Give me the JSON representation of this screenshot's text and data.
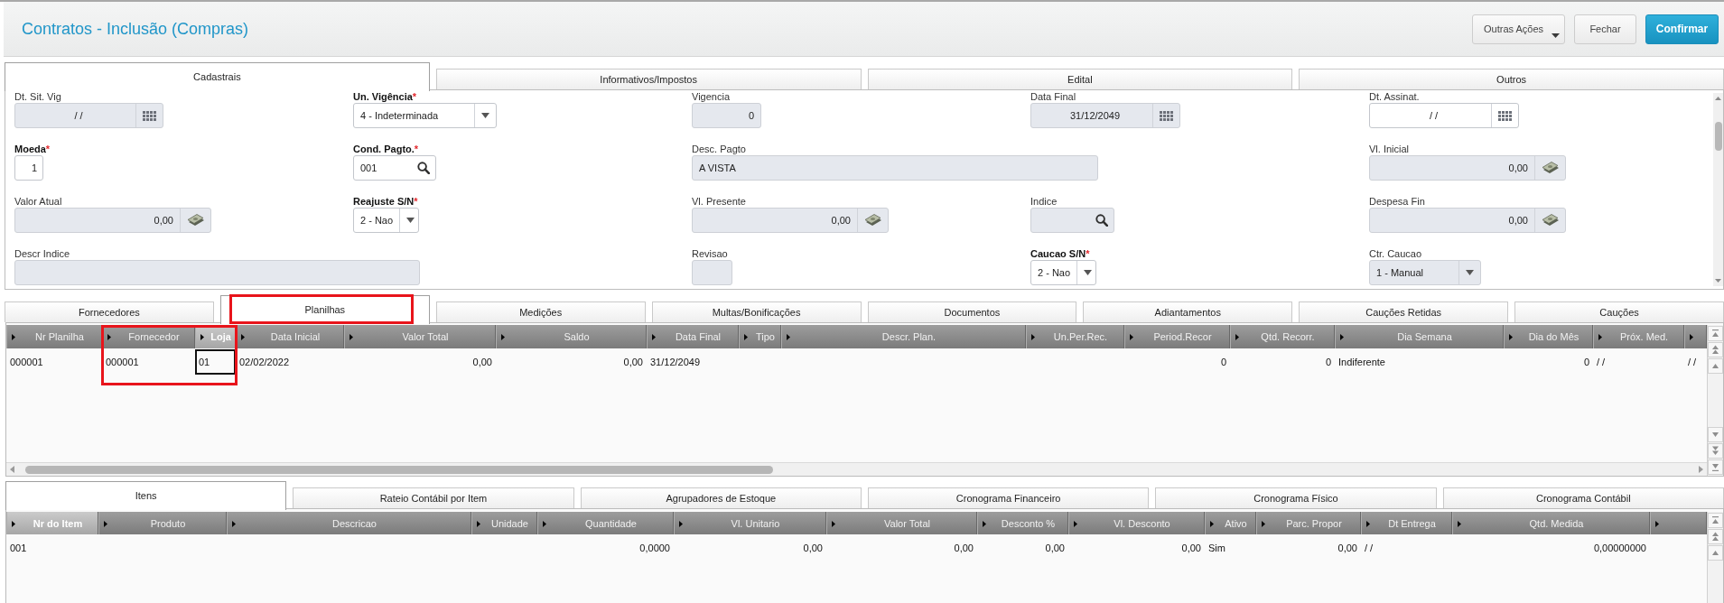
{
  "header": {
    "title": "Contratos - Inclusão (Compras)",
    "buttons": [
      {
        "label": "Outras Ações",
        "kind": "menu"
      },
      {
        "label": "Fechar",
        "kind": "default"
      },
      {
        "label": "Confirmar",
        "kind": "primary"
      }
    ]
  },
  "main_tabs": [
    {
      "label": "Cadastrais",
      "selected": true
    },
    {
      "label": "Informativos/Impostos",
      "selected": false
    },
    {
      "label": "Edital",
      "selected": false
    },
    {
      "label": "Outros",
      "selected": false
    }
  ],
  "form": {
    "rows": [
      {
        "fields": [
          {
            "label": "Dt. Sit. Vig",
            "required": false,
            "kind": "date",
            "value": "/ /",
            "disabled": true
          },
          {
            "label": "Un. Vigência",
            "required": true,
            "required_mark": "*",
            "kind": "select",
            "value": "4 - Indeterminada",
            "disabled": false
          },
          {
            "label": "Vigencia",
            "required": false,
            "kind": "number",
            "value": "0",
            "disabled": true
          },
          {
            "label": "Data Final",
            "required": false,
            "kind": "date",
            "value": "31/12/2049",
            "disabled": true
          },
          {
            "label": "Dt. Assinat.",
            "required": false,
            "kind": "date",
            "value": "/ /",
            "disabled": false
          }
        ]
      },
      {
        "fields": [
          {
            "label": "Moeda",
            "required": true,
            "required_mark": "*",
            "kind": "number",
            "value": "1",
            "disabled": false
          },
          {
            "label": "Cond. Pagto.",
            "required": true,
            "required_mark": "*",
            "kind": "lookup",
            "value": "001",
            "disabled": false
          },
          {
            "label": "Desc. Pagto",
            "required": false,
            "kind": "text",
            "value": "A VISTA",
            "disabled": true
          },
          {
            "label": "Vl. Inicial",
            "required": false,
            "kind": "money",
            "value": "0,00",
            "disabled": true
          }
        ]
      },
      {
        "fields": [
          {
            "label": "Valor Atual",
            "required": false,
            "kind": "money",
            "value": "0,00",
            "disabled": true
          },
          {
            "label": "Reajuste S/N",
            "required": true,
            "required_mark": "*",
            "kind": "select",
            "value": "2 - Nao",
            "disabled": false
          },
          {
            "label": "Vl. Presente",
            "required": false,
            "kind": "money",
            "value": "0,00",
            "disabled": true
          },
          {
            "label": "Indice",
            "required": false,
            "kind": "lookup",
            "disabled": true
          },
          {
            "label": "Despesa Fin",
            "required": false,
            "kind": "money",
            "value": "0,00",
            "disabled": true
          }
        ]
      },
      {
        "fields": [
          {
            "label": "Descr Indice",
            "required": false,
            "kind": "text",
            "disabled": true
          },
          {
            "label": "Revisao",
            "required": false,
            "kind": "number",
            "disabled": true
          },
          {
            "label": "Caucao S/N",
            "required": true,
            "required_mark": "*",
            "kind": "select",
            "value": "2 - Nao",
            "disabled": false
          },
          {
            "label": "Ctr. Caucao",
            "required": false,
            "kind": "select",
            "value": "1 - Manual",
            "disabled": true
          }
        ]
      }
    ]
  },
  "sub_tabs": [
    {
      "label": "Fornecedores",
      "selected": false,
      "highlighted": false
    },
    {
      "label": "Planilhas",
      "selected": true,
      "highlighted": true
    },
    {
      "label": "Medições",
      "selected": false,
      "highlighted": false
    },
    {
      "label": "Multas/Bonificações",
      "selected": false,
      "highlighted": false
    },
    {
      "label": "Documentos",
      "selected": false,
      "highlighted": false
    },
    {
      "label": "Adiantamentos",
      "selected": false,
      "highlighted": false
    },
    {
      "label": "Cauções Retidas",
      "selected": false,
      "highlighted": false
    },
    {
      "label": "Cauções",
      "selected": false,
      "highlighted": false
    }
  ],
  "planilhas": {
    "columns": [
      {
        "label": "Nr Planilha",
        "kind": "text",
        "selected": false,
        "highlighted": false
      },
      {
        "label": "Fornecedor",
        "kind": "text",
        "selected": false,
        "highlighted": true
      },
      {
        "label": "Loja",
        "kind": "text",
        "selected": true,
        "highlighted": true
      },
      {
        "label": "Data Inicial",
        "kind": "text",
        "selected": false,
        "highlighted": false
      },
      {
        "label": "Valor Total",
        "kind": "numeric",
        "selected": false,
        "highlighted": false
      },
      {
        "label": "Saldo",
        "kind": "numeric",
        "selected": false,
        "highlighted": false
      },
      {
        "label": "Data Final",
        "kind": "text",
        "selected": false,
        "highlighted": false
      },
      {
        "label": "Tipo",
        "kind": "text",
        "selected": false,
        "highlighted": false
      },
      {
        "label": "Descr. Plan.",
        "kind": "text",
        "selected": false,
        "highlighted": false
      },
      {
        "label": "Un.Per.Rec.",
        "kind": "text",
        "selected": false,
        "highlighted": false
      },
      {
        "label": "Period.Recor",
        "kind": "numeric",
        "selected": false,
        "highlighted": false
      },
      {
        "label": "Qtd. Recorr.",
        "kind": "numeric",
        "selected": false,
        "highlighted": false
      },
      {
        "label": "Dia Semana",
        "kind": "text",
        "selected": false,
        "highlighted": false
      },
      {
        "label": "Dia do Mês",
        "kind": "numeric",
        "selected": false,
        "highlighted": false
      },
      {
        "label": "Próx. Med.",
        "kind": "text",
        "selected": false,
        "highlighted": false
      },
      {
        "kind": "text",
        "selected": false,
        "highlighted": false
      }
    ],
    "rows": [
      {
        "selected": true,
        "cells": [
          "000001",
          "000001",
          "01",
          "02/02/2022",
          "0,00",
          "0,00",
          "31/12/2049",
          null,
          null,
          null,
          "0",
          "0",
          "Indiferente",
          "0",
          "/ /",
          "/ /"
        ]
      }
    ]
  },
  "item_tabs": [
    {
      "label": "Itens",
      "selected": true
    },
    {
      "label": "Rateio Contábil por Item",
      "selected": false
    },
    {
      "label": "Agrupadores de Estoque",
      "selected": false
    },
    {
      "label": "Cronograma Financeiro",
      "selected": false
    },
    {
      "label": "Cronograma Físico",
      "selected": false
    },
    {
      "label": "Cronograma Contábil",
      "selected": false
    }
  ],
  "items": {
    "columns": [
      {
        "label": "Nr do Item",
        "kind": "text",
        "selected": true,
        "highlighted": false
      },
      {
        "label": "Produto",
        "kind": "text",
        "selected": false,
        "highlighted": false
      },
      {
        "label": "Descricao",
        "kind": "text",
        "selected": false,
        "highlighted": false
      },
      {
        "label": "Unidade",
        "kind": "text",
        "selected": false,
        "highlighted": false
      },
      {
        "label": "Quantidade",
        "kind": "numeric",
        "selected": false,
        "highlighted": false
      },
      {
        "label": "Vl. Unitario",
        "kind": "numeric",
        "selected": false,
        "highlighted": false
      },
      {
        "label": "Valor Total",
        "kind": "numeric",
        "selected": false,
        "highlighted": false
      },
      {
        "label": "Desconto %",
        "kind": "numeric",
        "selected": false,
        "highlighted": false
      },
      {
        "label": "Vl. Desconto",
        "kind": "numeric",
        "selected": false,
        "highlighted": false
      },
      {
        "label": "Ativo",
        "kind": "text",
        "selected": false,
        "highlighted": false
      },
      {
        "label": "Parc. Propor",
        "kind": "numeric",
        "selected": false,
        "highlighted": false
      },
      {
        "label": "Dt Entrega",
        "kind": "text",
        "selected": false,
        "highlighted": false
      },
      {
        "label": "Qtd. Medida",
        "kind": "numeric",
        "selected": false,
        "highlighted": false
      },
      {
        "kind": "text",
        "selected": false,
        "highlighted": false
      }
    ],
    "rows": [
      {
        "selected": false,
        "cells": [
          "001",
          null,
          null,
          null,
          "0,0000",
          "0,00",
          "0,00",
          "0,00",
          "0,00",
          "Sim",
          "0,00",
          "/ /",
          "0,00000000",
          null
        ]
      }
    ]
  }
}
